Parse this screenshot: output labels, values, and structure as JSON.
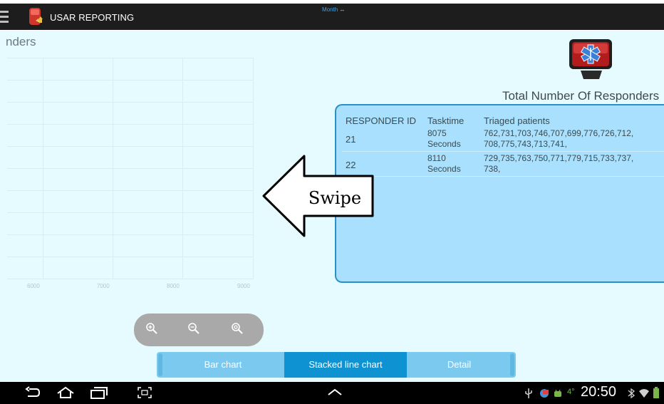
{
  "app": {
    "title": "USAR REPORTING",
    "period_label": "Month",
    "period_arrow": "↔"
  },
  "left_chart": {
    "title": "nders",
    "x_ticks": [
      "6000",
      "7000",
      "8000",
      "9000"
    ]
  },
  "zoom_controls": [
    "zoom-in-icon",
    "zoom-out-icon",
    "zoom-reset-icon"
  ],
  "tabs": [
    {
      "label": "Bar chart",
      "active": false
    },
    {
      "label": "Stacked line chart",
      "active": true
    },
    {
      "label": "Detail",
      "active": false
    }
  ],
  "panel": {
    "title": "Total Number Of Responders",
    "headers": [
      "RESPONDER ID",
      "Tasktime",
      "Triaged patients"
    ],
    "rows": [
      {
        "id": "21",
        "time_line1": "8075",
        "time_line2": "Seconds",
        "patients_line1": "762,731,703,746,707,699,776,726,712,",
        "patients_line2": "708,775,743,713,741,"
      },
      {
        "id": "22",
        "time_line1": "8110",
        "time_line2": "Seconds",
        "patients_line1": "729,735,763,750,771,779,715,733,737,",
        "patients_line2": "738,"
      }
    ]
  },
  "overlay": {
    "swipe_label": "Swipe"
  },
  "system_bar": {
    "clock": "20:50",
    "icons": [
      "back-icon",
      "home-icon",
      "recent-apps-icon",
      "screenshot-icon",
      "up-chevron-icon",
      "usb-icon",
      "android-icon",
      "temperature-icon",
      "bluetooth-icon",
      "wifi-icon",
      "battery-icon"
    ],
    "temperature": "4°"
  },
  "colors": {
    "content_bg": "#e6fbff",
    "panel_bg": "#a9e0fd",
    "tab_active": "#0e92d1",
    "tab_inactive": "#7bc9ee"
  }
}
